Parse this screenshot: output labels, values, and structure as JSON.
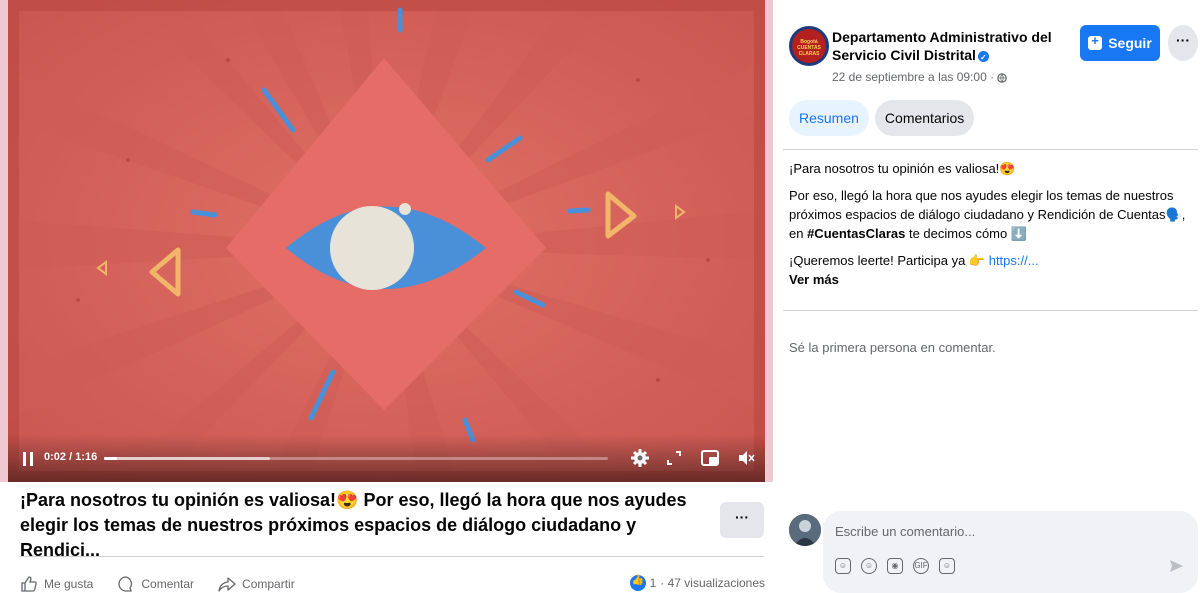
{
  "video": {
    "time": "0:02 / 1:16",
    "progress_fraction": 0.026,
    "buffered_fraction": 0.33
  },
  "post": {
    "title_line1": "¡Para nosotros tu opinión es valiosa!😍 Por eso, llegó la hora que nos ayudes",
    "title_line2": "elegir los temas de nuestros próximos espacios de diálogo ciudadano y Rendici...",
    "more_label": "···"
  },
  "actions": {
    "like": "Me gusta",
    "comment": "Comentar",
    "share": "Compartir"
  },
  "stats": {
    "reactions": "1",
    "views": " · 47 visualizaciones"
  },
  "page": {
    "logo_text": "Bogotá CUENTAS CLARAS",
    "name_line1": "Departamento Administrativo del",
    "name_line2": "Servicio Civil Distrital",
    "date": "22 de septiembre a las 09:00 · ",
    "follow_label": "Seguir",
    "more_label": "···"
  },
  "tabs": [
    {
      "label": "Resumen",
      "active": true
    },
    {
      "label": "Comentarios",
      "active": false
    }
  ],
  "body": {
    "p1": "¡Para nosotros tu opinión es valiosa!😍",
    "p2_a": "Por eso, llegó la hora que nos ayudes elegir los temas de nuestros próximos espacios de diálogo ciudadano y Rendición de Cuentas🗣️, en ",
    "p2_hashtag": "#CuentasClaras",
    "p2_b": " te decimos cómo ⬇️",
    "p3_a": "¡Queremos leerte! Participa ya 👉 ",
    "p3_link": "https://...",
    "see_more": "Ver más"
  },
  "comments": {
    "empty_text": "Sé la primera persona en comentar.",
    "input_placeholder": "Escribe un comentario..."
  },
  "colors": {
    "accent": "#1877f2",
    "video_bg": "#d9665e",
    "diamond": "#e2706a",
    "eye": "#4a90d9"
  }
}
